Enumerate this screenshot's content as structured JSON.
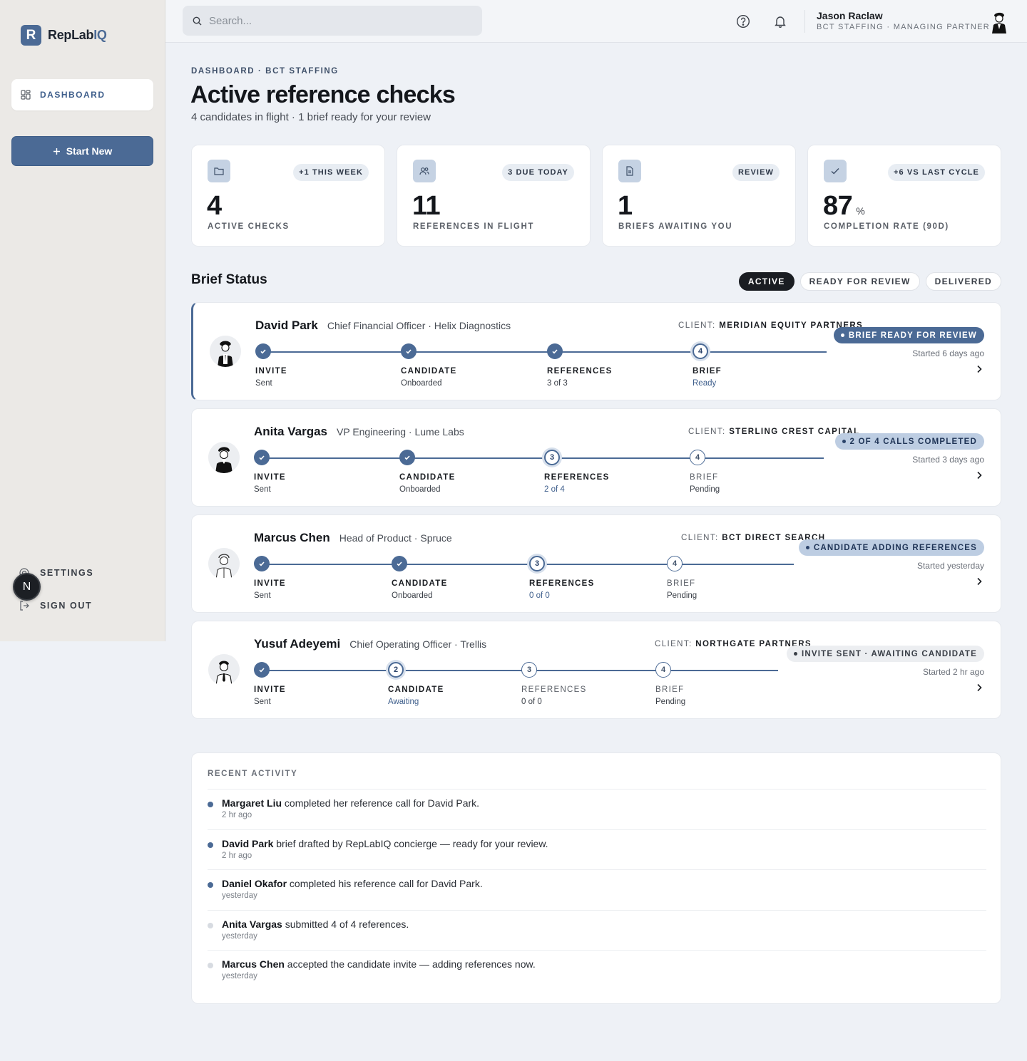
{
  "app": {
    "logo_mark": "R",
    "logo_text": "RepLab",
    "logo_text_accent": "IQ",
    "icons": {
      "dashboard": "grid-icon",
      "start": "plus-icon",
      "settings": "gear-icon",
      "signout": "logout-icon"
    }
  },
  "sidebar": {
    "dashboard_label": "DASHBOARD",
    "start_label": "Start New",
    "settings_label": "SETTINGS",
    "signout_label": "SIGN OUT",
    "avatar_letter": "N"
  },
  "topbar": {
    "search_placeholder": "Search...",
    "user_name": "Jason Raclaw",
    "user_role": "BCT STAFFING · MANAGING PARTNER"
  },
  "header": {
    "breadcrumb": "DASHBOARD · BCT STAFFING",
    "title": "Active reference checks",
    "subtitle": "4 candidates in flight · 1 brief ready for your review"
  },
  "stats": [
    {
      "badge": "+1 THIS WEEK",
      "value": "4",
      "unit": "",
      "label": "ACTIVE CHECKS",
      "icon": "folder-icon"
    },
    {
      "badge": "3 DUE TODAY",
      "value": "11",
      "unit": "",
      "label": "REFERENCES IN FLIGHT",
      "icon": "users-icon"
    },
    {
      "badge": "REVIEW",
      "value": "1",
      "unit": "",
      "label": "BRIEFS AWAITING YOU",
      "icon": "document-icon"
    },
    {
      "badge": "+6 VS LAST CYCLE",
      "value": "87",
      "unit": "%",
      "label": "COMPLETION RATE (90D)",
      "icon": "check-icon"
    }
  ],
  "brief_status": {
    "title": "Brief Status",
    "filters": [
      "ACTIVE",
      "READY FOR REVIEW",
      "DELIVERED"
    ],
    "client_prefix": "CLIENT:",
    "step_labels": [
      "INVITE",
      "CANDIDATE",
      "REFERENCES",
      "BRIEF"
    ],
    "items": [
      {
        "name": "David Park",
        "role": "Chief Financial Officer · Helix Diagnostics",
        "client": "MERIDIAN EQUITY PARTNERS",
        "status": "BRIEF READY FOR REVIEW",
        "started": "Started 6 days ago",
        "steps": [
          {
            "state": "done",
            "sub": "Sent"
          },
          {
            "state": "done",
            "sub": "Onboarded"
          },
          {
            "state": "done",
            "sub": "3 of 3"
          },
          {
            "state": "current",
            "num": "4",
            "sub": "Ready"
          }
        ]
      },
      {
        "name": "Anita Vargas",
        "role": "VP Engineering · Lume Labs",
        "client": "STERLING CREST CAPITAL",
        "status": "2 OF 4 CALLS COMPLETED",
        "started": "Started 3 days ago",
        "steps": [
          {
            "state": "done",
            "sub": "Sent"
          },
          {
            "state": "done",
            "sub": "Onboarded"
          },
          {
            "state": "current",
            "num": "3",
            "sub": "2 of 4"
          },
          {
            "state": "todo",
            "num": "4",
            "sub": "Pending"
          }
        ]
      },
      {
        "name": "Marcus Chen",
        "role": "Head of Product · Spruce",
        "client": "BCT DIRECT SEARCH",
        "status": "CANDIDATE ADDING REFERENCES",
        "started": "Started yesterday",
        "steps": [
          {
            "state": "done",
            "sub": "Sent"
          },
          {
            "state": "done",
            "sub": "Onboarded"
          },
          {
            "state": "current",
            "num": "3",
            "sub": "0 of 0"
          },
          {
            "state": "todo",
            "num": "4",
            "sub": "Pending"
          }
        ]
      },
      {
        "name": "Yusuf Adeyemi",
        "role": "Chief Operating Officer · Trellis",
        "client": "NORTHGATE PARTNERS",
        "status": "INVITE SENT · AWAITING CANDIDATE",
        "started": "Started 2 hr ago",
        "steps": [
          {
            "state": "done",
            "sub": "Sent"
          },
          {
            "state": "current",
            "num": "2",
            "sub": "Awaiting"
          },
          {
            "state": "todo",
            "num": "3",
            "sub": "0 of 0"
          },
          {
            "state": "todo",
            "num": "4",
            "sub": "Pending"
          }
        ]
      }
    ]
  },
  "activity": {
    "title": "RECENT ACTIVITY",
    "items": [
      {
        "actor": "Margaret Liu",
        "text": " completed her reference call for David Park.",
        "time": "2 hr ago",
        "fresh": true
      },
      {
        "actor": "David Park",
        "text": " brief drafted by RepLabIQ concierge — ready for your review.",
        "time": "2 hr ago",
        "fresh": true
      },
      {
        "actor": "Daniel Okafor",
        "text": " completed his reference call for David Park.",
        "time": "yesterday",
        "fresh": true
      },
      {
        "actor": "Anita Vargas",
        "text": " submitted 4 of 4 references.",
        "time": "yesterday",
        "fresh": false
      },
      {
        "actor": "Marcus Chen",
        "text": " accepted the candidate invite — adding references now.",
        "time": "yesterday",
        "fresh": false
      }
    ]
  },
  "colors": {
    "accent": "#4b6a95",
    "dark": "#1a1d22",
    "badge_bg": "#bdcde2"
  }
}
